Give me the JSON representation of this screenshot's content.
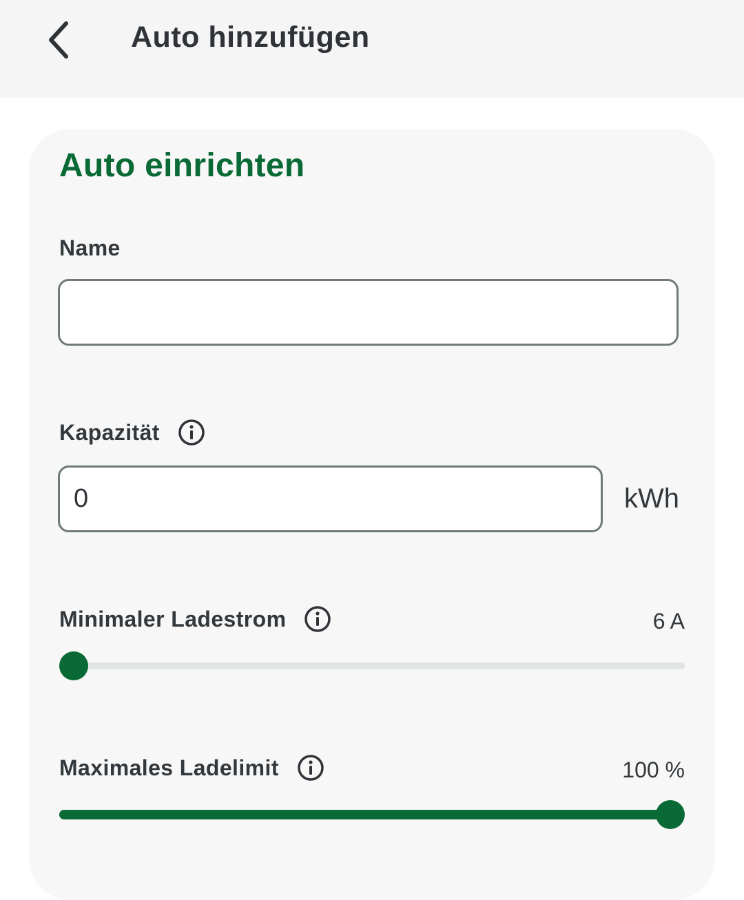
{
  "header": {
    "title": "Auto hinzufügen",
    "back_icon": "chevron-left-icon"
  },
  "card": {
    "title": "Auto einrichten",
    "name_field": {
      "label": "Name",
      "value": "",
      "placeholder": ""
    },
    "capacity_field": {
      "label": "Kapazität",
      "value": "0",
      "unit": "kWh",
      "info_icon": "info-icon"
    },
    "min_charge_current": {
      "label": "Minimaler Ladestrom",
      "value_text": "6 A",
      "level": 0.0,
      "info_icon": "info-icon"
    },
    "max_charge_limit": {
      "label": "Maximales Ladelimit",
      "value_text": "100 %",
      "level": 1.0,
      "info_icon": "info-icon"
    }
  },
  "colors": {
    "accent": "#0a6a35",
    "header_bg": "#f5f5f5",
    "card_bg": "#f7f7f7",
    "text": "#2f3337",
    "input_border": "#6f7a79",
    "track": "#e1e6e2"
  }
}
